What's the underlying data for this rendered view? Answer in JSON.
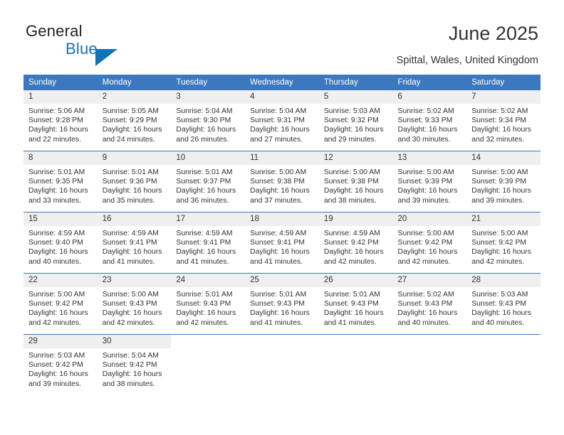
{
  "brand": {
    "name_line1": "General",
    "name_line2": "Blue",
    "logo_icon": "triangle-logo-icon",
    "accent_color": "#1272b8"
  },
  "header": {
    "title": "June 2025",
    "location": "Spittal, Wales, United Kingdom"
  },
  "theme": {
    "header_blue": "#3c78bd",
    "daynum_gray": "#efefef",
    "text_color": "#333333"
  },
  "calendar": {
    "weekday_headers": [
      "Sunday",
      "Monday",
      "Tuesday",
      "Wednesday",
      "Thursday",
      "Friday",
      "Saturday"
    ],
    "weeks": [
      [
        {
          "day": "1",
          "sunrise": "Sunrise: 5:06 AM",
          "sunset": "Sunset: 9:28 PM",
          "daylight_line1": "Daylight: 16 hours",
          "daylight_line2": "and 22 minutes."
        },
        {
          "day": "2",
          "sunrise": "Sunrise: 5:05 AM",
          "sunset": "Sunset: 9:29 PM",
          "daylight_line1": "Daylight: 16 hours",
          "daylight_line2": "and 24 minutes."
        },
        {
          "day": "3",
          "sunrise": "Sunrise: 5:04 AM",
          "sunset": "Sunset: 9:30 PM",
          "daylight_line1": "Daylight: 16 hours",
          "daylight_line2": "and 26 minutes."
        },
        {
          "day": "4",
          "sunrise": "Sunrise: 5:04 AM",
          "sunset": "Sunset: 9:31 PM",
          "daylight_line1": "Daylight: 16 hours",
          "daylight_line2": "and 27 minutes."
        },
        {
          "day": "5",
          "sunrise": "Sunrise: 5:03 AM",
          "sunset": "Sunset: 9:32 PM",
          "daylight_line1": "Daylight: 16 hours",
          "daylight_line2": "and 29 minutes."
        },
        {
          "day": "6",
          "sunrise": "Sunrise: 5:02 AM",
          "sunset": "Sunset: 9:33 PM",
          "daylight_line1": "Daylight: 16 hours",
          "daylight_line2": "and 30 minutes."
        },
        {
          "day": "7",
          "sunrise": "Sunrise: 5:02 AM",
          "sunset": "Sunset: 9:34 PM",
          "daylight_line1": "Daylight: 16 hours",
          "daylight_line2": "and 32 minutes."
        }
      ],
      [
        {
          "day": "8",
          "sunrise": "Sunrise: 5:01 AM",
          "sunset": "Sunset: 9:35 PM",
          "daylight_line1": "Daylight: 16 hours",
          "daylight_line2": "and 33 minutes."
        },
        {
          "day": "9",
          "sunrise": "Sunrise: 5:01 AM",
          "sunset": "Sunset: 9:36 PM",
          "daylight_line1": "Daylight: 16 hours",
          "daylight_line2": "and 35 minutes."
        },
        {
          "day": "10",
          "sunrise": "Sunrise: 5:01 AM",
          "sunset": "Sunset: 9:37 PM",
          "daylight_line1": "Daylight: 16 hours",
          "daylight_line2": "and 36 minutes."
        },
        {
          "day": "11",
          "sunrise": "Sunrise: 5:00 AM",
          "sunset": "Sunset: 9:38 PM",
          "daylight_line1": "Daylight: 16 hours",
          "daylight_line2": "and 37 minutes."
        },
        {
          "day": "12",
          "sunrise": "Sunrise: 5:00 AM",
          "sunset": "Sunset: 9:38 PM",
          "daylight_line1": "Daylight: 16 hours",
          "daylight_line2": "and 38 minutes."
        },
        {
          "day": "13",
          "sunrise": "Sunrise: 5:00 AM",
          "sunset": "Sunset: 9:39 PM",
          "daylight_line1": "Daylight: 16 hours",
          "daylight_line2": "and 39 minutes."
        },
        {
          "day": "14",
          "sunrise": "Sunrise: 5:00 AM",
          "sunset": "Sunset: 9:39 PM",
          "daylight_line1": "Daylight: 16 hours",
          "daylight_line2": "and 39 minutes."
        }
      ],
      [
        {
          "day": "15",
          "sunrise": "Sunrise: 4:59 AM",
          "sunset": "Sunset: 9:40 PM",
          "daylight_line1": "Daylight: 16 hours",
          "daylight_line2": "and 40 minutes."
        },
        {
          "day": "16",
          "sunrise": "Sunrise: 4:59 AM",
          "sunset": "Sunset: 9:41 PM",
          "daylight_line1": "Daylight: 16 hours",
          "daylight_line2": "and 41 minutes."
        },
        {
          "day": "17",
          "sunrise": "Sunrise: 4:59 AM",
          "sunset": "Sunset: 9:41 PM",
          "daylight_line1": "Daylight: 16 hours",
          "daylight_line2": "and 41 minutes."
        },
        {
          "day": "18",
          "sunrise": "Sunrise: 4:59 AM",
          "sunset": "Sunset: 9:41 PM",
          "daylight_line1": "Daylight: 16 hours",
          "daylight_line2": "and 41 minutes."
        },
        {
          "day": "19",
          "sunrise": "Sunrise: 4:59 AM",
          "sunset": "Sunset: 9:42 PM",
          "daylight_line1": "Daylight: 16 hours",
          "daylight_line2": "and 42 minutes."
        },
        {
          "day": "20",
          "sunrise": "Sunrise: 5:00 AM",
          "sunset": "Sunset: 9:42 PM",
          "daylight_line1": "Daylight: 16 hours",
          "daylight_line2": "and 42 minutes."
        },
        {
          "day": "21",
          "sunrise": "Sunrise: 5:00 AM",
          "sunset": "Sunset: 9:42 PM",
          "daylight_line1": "Daylight: 16 hours",
          "daylight_line2": "and 42 minutes."
        }
      ],
      [
        {
          "day": "22",
          "sunrise": "Sunrise: 5:00 AM",
          "sunset": "Sunset: 9:42 PM",
          "daylight_line1": "Daylight: 16 hours",
          "daylight_line2": "and 42 minutes."
        },
        {
          "day": "23",
          "sunrise": "Sunrise: 5:00 AM",
          "sunset": "Sunset: 9:43 PM",
          "daylight_line1": "Daylight: 16 hours",
          "daylight_line2": "and 42 minutes."
        },
        {
          "day": "24",
          "sunrise": "Sunrise: 5:01 AM",
          "sunset": "Sunset: 9:43 PM",
          "daylight_line1": "Daylight: 16 hours",
          "daylight_line2": "and 42 minutes."
        },
        {
          "day": "25",
          "sunrise": "Sunrise: 5:01 AM",
          "sunset": "Sunset: 9:43 PM",
          "daylight_line1": "Daylight: 16 hours",
          "daylight_line2": "and 41 minutes."
        },
        {
          "day": "26",
          "sunrise": "Sunrise: 5:01 AM",
          "sunset": "Sunset: 9:43 PM",
          "daylight_line1": "Daylight: 16 hours",
          "daylight_line2": "and 41 minutes."
        },
        {
          "day": "27",
          "sunrise": "Sunrise: 5:02 AM",
          "sunset": "Sunset: 9:43 PM",
          "daylight_line1": "Daylight: 16 hours",
          "daylight_line2": "and 40 minutes."
        },
        {
          "day": "28",
          "sunrise": "Sunrise: 5:03 AM",
          "sunset": "Sunset: 9:43 PM",
          "daylight_line1": "Daylight: 16 hours",
          "daylight_line2": "and 40 minutes."
        }
      ],
      [
        {
          "day": "29",
          "sunrise": "Sunrise: 5:03 AM",
          "sunset": "Sunset: 9:42 PM",
          "daylight_line1": "Daylight: 16 hours",
          "daylight_line2": "and 39 minutes."
        },
        {
          "day": "30",
          "sunrise": "Sunrise: 5:04 AM",
          "sunset": "Sunset: 9:42 PM",
          "daylight_line1": "Daylight: 16 hours",
          "daylight_line2": "and 38 minutes."
        },
        {
          "day": "",
          "sunrise": "",
          "sunset": "",
          "daylight_line1": "",
          "daylight_line2": ""
        },
        {
          "day": "",
          "sunrise": "",
          "sunset": "",
          "daylight_line1": "",
          "daylight_line2": ""
        },
        {
          "day": "",
          "sunrise": "",
          "sunset": "",
          "daylight_line1": "",
          "daylight_line2": ""
        },
        {
          "day": "",
          "sunrise": "",
          "sunset": "",
          "daylight_line1": "",
          "daylight_line2": ""
        },
        {
          "day": "",
          "sunrise": "",
          "sunset": "",
          "daylight_line1": "",
          "daylight_line2": ""
        }
      ]
    ]
  }
}
